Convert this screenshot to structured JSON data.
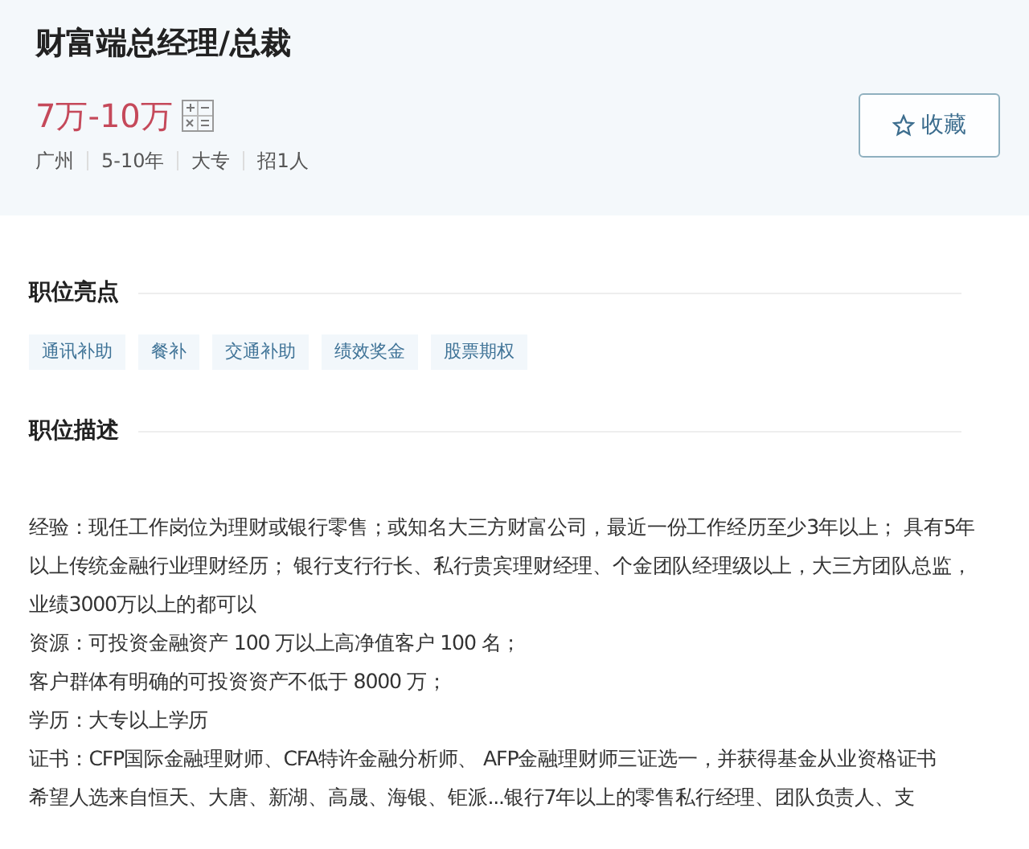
{
  "job": {
    "title": "财富端总经理/总裁",
    "salary": "7万-10万",
    "meta": [
      "广州",
      "5-10年",
      "大专",
      "招1人"
    ],
    "collect_button": "收藏"
  },
  "highlights": {
    "heading": "职位亮点",
    "tags": [
      "通讯补助",
      "餐补",
      "交通补助",
      "绩效奖金",
      "股票期权"
    ]
  },
  "description": {
    "heading": "职位描述",
    "paragraphs": [
      "经验：现任工作岗位为理财或银行零售；或知名大三方财富公司，最近一份工作经历至少3年以上； 具有5年以上传统金融行业理财经历； 银行支行行长、私行贵宾理财经理、个金团队经理级以上，大三方团队总监，业绩3000万以上的都可以",
      "资源：可投资金融资产 100 万以上高净值客户 100 名；",
      "客户群体有明确的可投资资产不低于 8000 万；",
      "学历：大专以上学历",
      "证书：CFP国际金融理财师、CFA特许金融分析师、 AFP金融理财师三证选一，并获得基金从业资格证书",
      "希望人选来自恒天、大唐、新湖、高晟、海银、钜派...银行7年以上的零售私行经理、团队负责人、支"
    ]
  }
}
